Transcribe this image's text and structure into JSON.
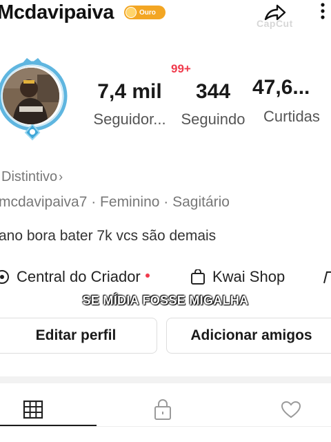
{
  "profile": {
    "username": "Mcdavipaiva",
    "badge_label": "Ouro",
    "watermark": "CapCut",
    "notification_count": "99+",
    "distintivo_label": "Distintivo",
    "distintivo_chevron": "›",
    "info_line": "mcdavipaiva7 · Feminino · Sagitário",
    "bio": "ano bora bater 7k vcs são demais"
  },
  "stats": [
    {
      "value": "7,4 mil",
      "label": "Seguidor..."
    },
    {
      "value": "344",
      "label": "Seguindo"
    },
    {
      "value": "47,6...",
      "label": "Curtidas"
    }
  ],
  "links": {
    "creator_center": "Central do Criador",
    "shop": "Kwai Shop"
  },
  "caption": "SE MÍDIA FOSSE MIGALHA",
  "buttons": {
    "edit_profile": "Editar perfil",
    "add_friends": "Adicionar amigos"
  },
  "tabs": [
    {
      "name": "grid",
      "icon": "grid-icon",
      "selected": true
    },
    {
      "name": "private",
      "icon": "lock-icon",
      "selected": false
    },
    {
      "name": "liked",
      "icon": "heart-icon",
      "selected": false
    }
  ],
  "colors": {
    "accent_red": "#f03a4c",
    "badge_gold": "#f3a623",
    "avatar_ring": "#5fb6e0"
  }
}
